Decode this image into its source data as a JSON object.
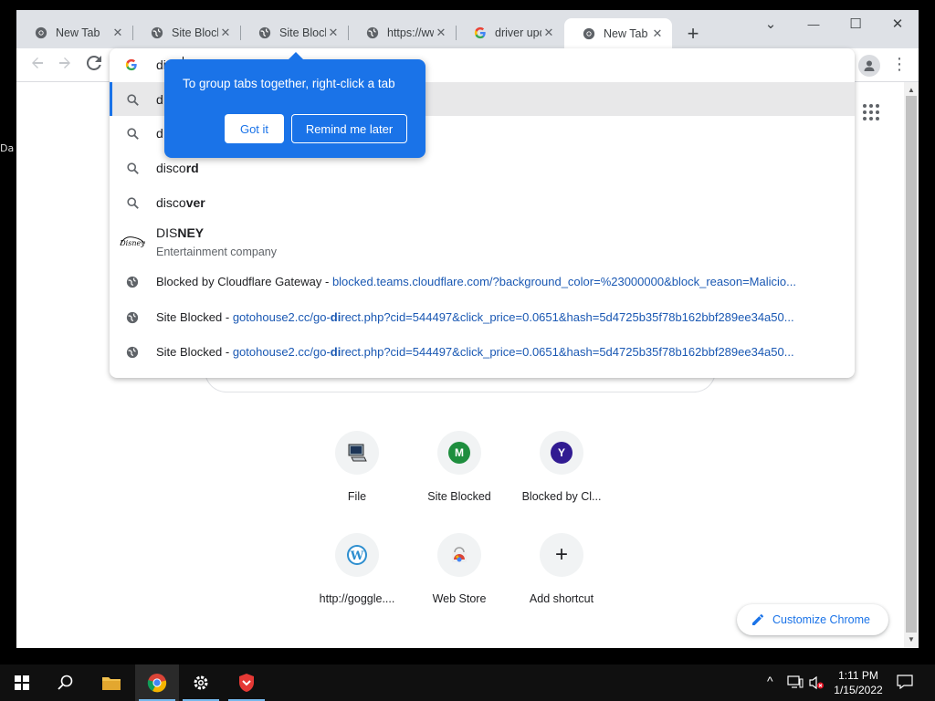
{
  "desktop": {
    "fragment_label": "Da"
  },
  "tabs": [
    {
      "title": "New Tab",
      "favicon": "chrome-icon",
      "active": false
    },
    {
      "title": "Site Blocked",
      "favicon": "globe-icon",
      "active": false
    },
    {
      "title": "Site Blocked",
      "favicon": "globe-icon",
      "active": false
    },
    {
      "title": "https://www",
      "favicon": "globe-icon",
      "active": false
    },
    {
      "title": "driver updates",
      "favicon": "google-icon",
      "active": false
    },
    {
      "title": "New Tab",
      "favicon": "chrome-icon",
      "active": true
    }
  ],
  "window_controls": {
    "minimize": "—",
    "maximize": "☐",
    "close": "✕",
    "tab_search": "⌄"
  },
  "omnibox": {
    "typed_text": "dis",
    "suggestions": [
      {
        "kind": "search",
        "prefix": "d",
        "bold": "",
        "selected": true
      },
      {
        "kind": "search",
        "prefix": "d",
        "bold": "",
        "selected": false
      },
      {
        "kind": "search",
        "prefix": "disco",
        "bold": "rd",
        "selected": false
      },
      {
        "kind": "search",
        "prefix": "disco",
        "bold": "ver",
        "selected": false
      },
      {
        "kind": "entity",
        "prefix": "DIS",
        "bold": "NEY",
        "subtitle": "Entertainment company",
        "selected": false
      },
      {
        "kind": "history",
        "title": "Blocked by Cloudflare Gateway",
        "sep": " - ",
        "url": "blocked.teams.cloudflare.com/?background_color=%23000000&block_reason=Malicio...",
        "selected": false
      },
      {
        "kind": "history",
        "title": "Site Blocked",
        "sep": " - ",
        "url_pre": "gotohouse2.cc/go-",
        "url_bold": "di",
        "url_post": "rect.php?cid=544497&click_price=0.0651&hash=5d4725b35f78b162bbf289ee34a50...",
        "selected": false
      },
      {
        "kind": "history",
        "title": "Site Blocked",
        "sep": " - ",
        "url_pre": "gotohouse2.cc/go-",
        "url_bold": "di",
        "url_post": "rect.php?cid=544497&click_price=0.0651&hash=5d4725b35f78b162bbf289ee34a50...",
        "selected": false
      }
    ]
  },
  "tip_bubble": {
    "message": "To group tabs together, right-click a tab",
    "got_it": "Got it",
    "remind_later": "Remind me later"
  },
  "shortcuts": [
    {
      "label": "File",
      "icon": "computer-icon"
    },
    {
      "label": "Site Blocked",
      "icon": "letter-avatar",
      "letter": "M",
      "color": "#1e8e3e"
    },
    {
      "label": "Blocked by Cl...",
      "icon": "letter-avatar",
      "letter": "Y",
      "color": "#311b92"
    },
    {
      "label": "http://goggle....",
      "icon": "wordpress-icon"
    },
    {
      "label": "Web Store",
      "icon": "webstore-icon"
    },
    {
      "label": "Add shortcut",
      "icon": "plus-icon"
    }
  ],
  "customize_chrome": "Customize Chrome",
  "taskbar": {
    "time": "1:11 PM",
    "date": "1/15/2022",
    "apps": [
      "start-icon",
      "search-icon",
      "file-explorer-icon",
      "chrome-icon",
      "settings-icon",
      "shield-icon"
    ]
  },
  "colors": {
    "accent": "#1a73e8",
    "tabstrip": "#dee1e6",
    "taskbar": "#101010"
  }
}
